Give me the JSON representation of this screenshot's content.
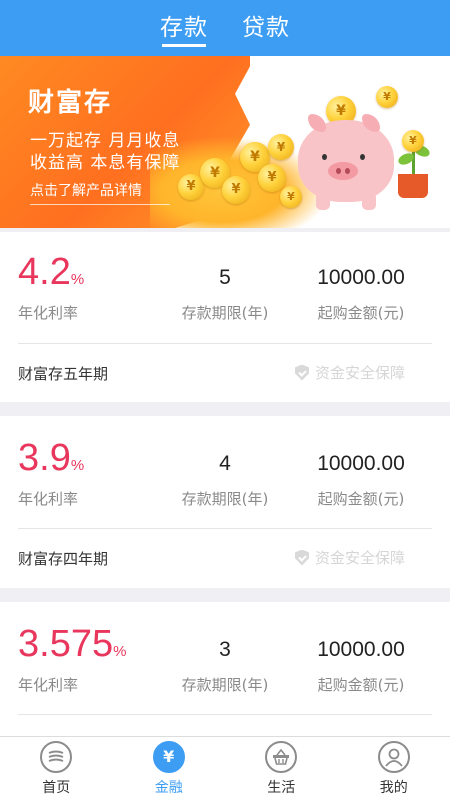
{
  "header": {
    "tabs": [
      {
        "label": "存款",
        "active": true
      },
      {
        "label": "贷款",
        "active": false
      }
    ]
  },
  "banner": {
    "title": "财富存",
    "line1": "一万起存 月月收息",
    "line2": "收益高 本息有保障",
    "cta": "点击了解产品详情",
    "coin_symbol": "¥"
  },
  "products": [
    {
      "rate": "4.2",
      "rate_unit": "%",
      "rate_label": "年化利率",
      "term": "5",
      "term_label": "存款期限(年)",
      "amount": "10000.00",
      "amount_label": "起购金额(元)",
      "name": "财富存五年期",
      "safety": "资金安全保障"
    },
    {
      "rate": "3.9",
      "rate_unit": "%",
      "rate_label": "年化利率",
      "term": "4",
      "term_label": "存款期限(年)",
      "amount": "10000.00",
      "amount_label": "起购金额(元)",
      "name": "财富存四年期",
      "safety": "资金安全保障"
    },
    {
      "rate": "3.575",
      "rate_unit": "%",
      "rate_label": "年化利率",
      "term": "3",
      "term_label": "存款期限(年)",
      "amount": "10000.00",
      "amount_label": "起购金额(元)"
    }
  ],
  "bottom_nav": [
    {
      "label": "首页",
      "icon": "home-icon",
      "active": false
    },
    {
      "label": "金融",
      "icon": "yuan-icon",
      "active": true,
      "glyph": "¥"
    },
    {
      "label": "生活",
      "icon": "basket-icon",
      "active": false
    },
    {
      "label": "我的",
      "icon": "user-icon",
      "active": false
    }
  ],
  "colors": {
    "primary": "#3d9df3",
    "rate": "#e8365c",
    "banner_orange": "#ff7a22"
  }
}
